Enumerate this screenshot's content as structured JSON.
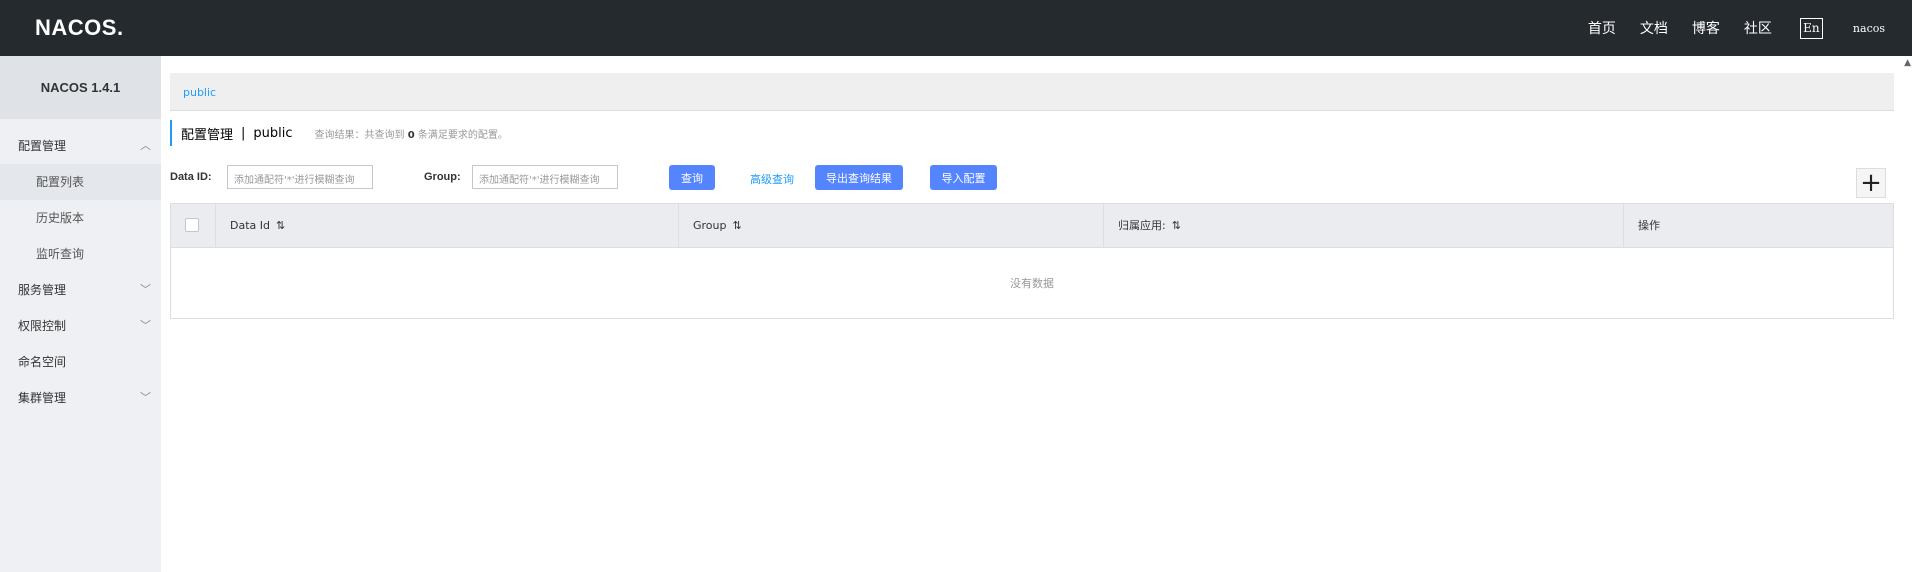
{
  "header": {
    "logo": "NACOS.",
    "nav": [
      "首页",
      "文档",
      "博客",
      "社区"
    ],
    "lang": "En",
    "user": "nacos"
  },
  "sidebar": {
    "version": "NACOS 1.4.1",
    "items": [
      {
        "label": "配置管理",
        "caret": "^"
      },
      {
        "label": "配置列表"
      },
      {
        "label": "历史版本"
      },
      {
        "label": "监听查询"
      },
      {
        "label": "服务管理",
        "caret": "v"
      },
      {
        "label": "权限控制",
        "caret": "v"
      },
      {
        "label": "命名空间"
      },
      {
        "label": "集群管理",
        "caret": "v"
      }
    ]
  },
  "main": {
    "namespace_tab": "public",
    "breadcrumb": {
      "title": "配置管理",
      "separator": "|",
      "namespace": "public",
      "info_prefix": "查询结果：共查询到",
      "info_count": "0",
      "info_suffix": "条满足要求的配置。"
    },
    "filters": {
      "data_id_label": "Data ID:",
      "data_id_placeholder": "添加通配符'*'进行模糊查询",
      "group_label": "Group:",
      "group_placeholder": "添加通配符'*'进行模糊查询",
      "search_button": "查询",
      "advanced_link": "高级查询",
      "export_button": "导出查询结果",
      "import_button": "导入配置",
      "add_button": "+"
    },
    "table": {
      "columns": [
        "Data Id",
        "Group",
        "归属应用:",
        "操作"
      ],
      "sort_icon": "⇅",
      "empty_text": "没有数据"
    }
  }
}
